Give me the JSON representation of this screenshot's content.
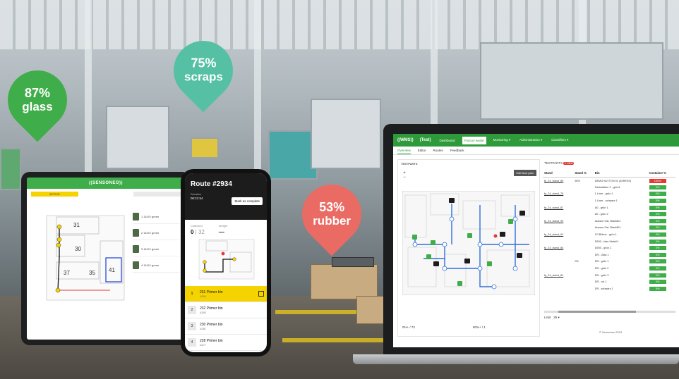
{
  "pins": {
    "glass": {
      "pct": "87%",
      "label": "glass",
      "color": "#3fae4a"
    },
    "scraps": {
      "pct": "75%",
      "label": "scraps",
      "color": "#55c0a4"
    },
    "rubber": {
      "pct": "53%",
      "label": "rubber",
      "color": "#ea6a64"
    }
  },
  "tablet": {
    "logo": "((SENSONEO))",
    "tabs": [
      "ACTIVE",
      "",
      ""
    ],
    "plan_labels": [
      "31",
      "30",
      "37",
      "35",
      "41"
    ],
    "bins": [
      {
        "label": "1 1100 l green"
      },
      {
        "label": "2 1100 l green"
      },
      {
        "label": "3 1100 l green"
      },
      {
        "label": "4 1100 l green"
      }
    ]
  },
  "phone": {
    "route": "Route #2934",
    "duration_label": "Duration",
    "duration": "00:21:54",
    "complete_button": "Mark as complete",
    "collected_label": "Collected",
    "collected": "0",
    "collected_total": "32",
    "weight_label": "Weight",
    "weight": "—",
    "items": [
      {
        "num": "1",
        "name": "231 Primer bin",
        "code": "A384"
      },
      {
        "num": "2",
        "name": "232 Primer bin",
        "code": "A383"
      },
      {
        "num": "3",
        "name": "230 Primer bin",
        "code": "A381"
      },
      {
        "num": "4",
        "name": "228 Primer bin",
        "code": "A377"
      }
    ]
  },
  "laptop": {
    "logo": "((WMS))",
    "env": "(Test)",
    "nav": [
      "Dashboard",
      "Factory waste",
      "Monitoring ▾",
      "Administration ▾",
      "Classifiers ▾"
    ],
    "subnav": [
      "Overview",
      "Editor",
      "Routes",
      "Feedback"
    ],
    "map_title": "TESTPARTS",
    "floor_plan_button": "Edit floor plan",
    "zoom_in": "+",
    "zoom_out": "−",
    "foot_left": "0%+ / 72",
    "foot_right": "90%+ / 1",
    "table_title": "TESTPARTS",
    "new_badge": "1 NEW",
    "headers": [
      "Stand",
      "Stand %",
      "Bin",
      "Container %"
    ],
    "rows": [
      {
        "stand": "fp_24_stand_89",
        "stand_pct": "50%",
        "bin": "DEMO BUTTON 01 (40RESS)",
        "container": "100%",
        "red": true
      },
      {
        "stand": "",
        "stand_pct": "",
        "bin": "Packstation 2 - grün1",
        "container": "0%",
        "red": false
      },
      {
        "stand": "fp_24_stand_75",
        "stand_pct": "",
        "bin": "1 Liner - grün 1",
        "container": "0%",
        "red": false
      },
      {
        "stand": "",
        "stand_pct": "",
        "bin": "1 Liner - schwarz 1",
        "container": "0%",
        "red": false
      },
      {
        "stand": "fp_24_stand_87",
        "stand_pct": "",
        "bin": "A0 - grün 1",
        "container": "0%",
        "red": false
      },
      {
        "stand": "",
        "stand_pct": "",
        "bin": "A0 - grün 2",
        "container": "0%",
        "red": false
      },
      {
        "stand": "fp_24_stand_93",
        "stand_pct": "",
        "bin": "Aussen Ost. BlauM01",
        "container": "0%",
        "red": false
      },
      {
        "stand": "",
        "stand_pct": "",
        "bin": "Aussen Ost. BlauM01",
        "container": "0%",
        "red": false
      },
      {
        "stand": "fp_24_stand_91",
        "stand_pct": "",
        "bin": "C0 Bühne - grün 1",
        "container": "0%",
        "red": false
      },
      {
        "stand": "",
        "stand_pct": "",
        "bin": "D500 - blau Metall 1",
        "container": "0%",
        "red": false
      },
      {
        "stand": "fp_24_stand_84",
        "stand_pct": "",
        "bin": "D500 - grün 1",
        "container": "0%",
        "red": false
      },
      {
        "stand": "",
        "stand_pct": "",
        "bin": "DR - Glas 1",
        "container": "0%",
        "red": false
      },
      {
        "stand": "",
        "stand_pct": "0%",
        "bin": "DR - grün 1",
        "container": "0%",
        "red": false
      },
      {
        "stand": "",
        "stand_pct": "",
        "bin": "DR - grün 2",
        "container": "0%",
        "red": false
      },
      {
        "stand": "fp_24_stand_81",
        "stand_pct": "",
        "bin": "DR - grün 3",
        "container": "0%",
        "red": false
      },
      {
        "stand": "",
        "stand_pct": "",
        "bin": "DR - rot 1",
        "container": "0%",
        "red": false
      },
      {
        "stand": "",
        "stand_pct": "",
        "bin": "DR - schwarz 1",
        "container": "0%",
        "red": false
      }
    ],
    "limit_label": "Limit",
    "limit_value": "25",
    "copyright": "© Sensoneo 2023"
  }
}
